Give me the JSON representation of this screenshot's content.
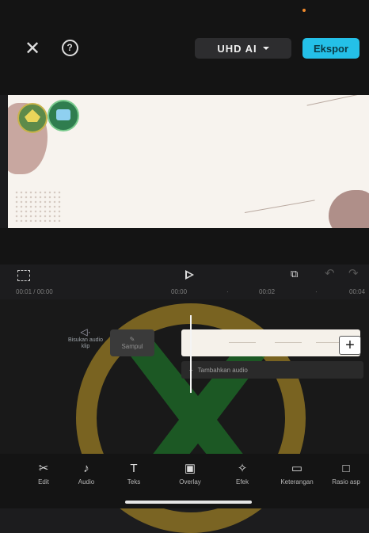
{
  "header": {
    "close_icon": "close-icon",
    "help_icon": "help-icon",
    "quality_label": "UHD AI",
    "export_label": "Ekspor",
    "export_color": "#24c0e8"
  },
  "playback": {
    "current_time": "00:01",
    "total_time": "00:00",
    "ruler_ticks": [
      "00:00",
      "00:02",
      "00:04"
    ]
  },
  "timeline": {
    "mute_label": "Bisukan audio klip",
    "cover_label": "Sampul",
    "add_audio_label": "Tambahkan audio"
  },
  "toolbar": {
    "items": [
      {
        "label": "Edit",
        "icon": "scissors-icon"
      },
      {
        "label": "Audio",
        "icon": "music-note-icon"
      },
      {
        "label": "Teks",
        "icon": "text-icon"
      },
      {
        "label": "Overlay",
        "icon": "overlay-icon"
      },
      {
        "label": "Efek",
        "icon": "effects-icon"
      },
      {
        "label": "Keterangan",
        "icon": "captions-icon"
      },
      {
        "label": "Rasio asp",
        "icon": "aspect-ratio-icon"
      }
    ]
  }
}
